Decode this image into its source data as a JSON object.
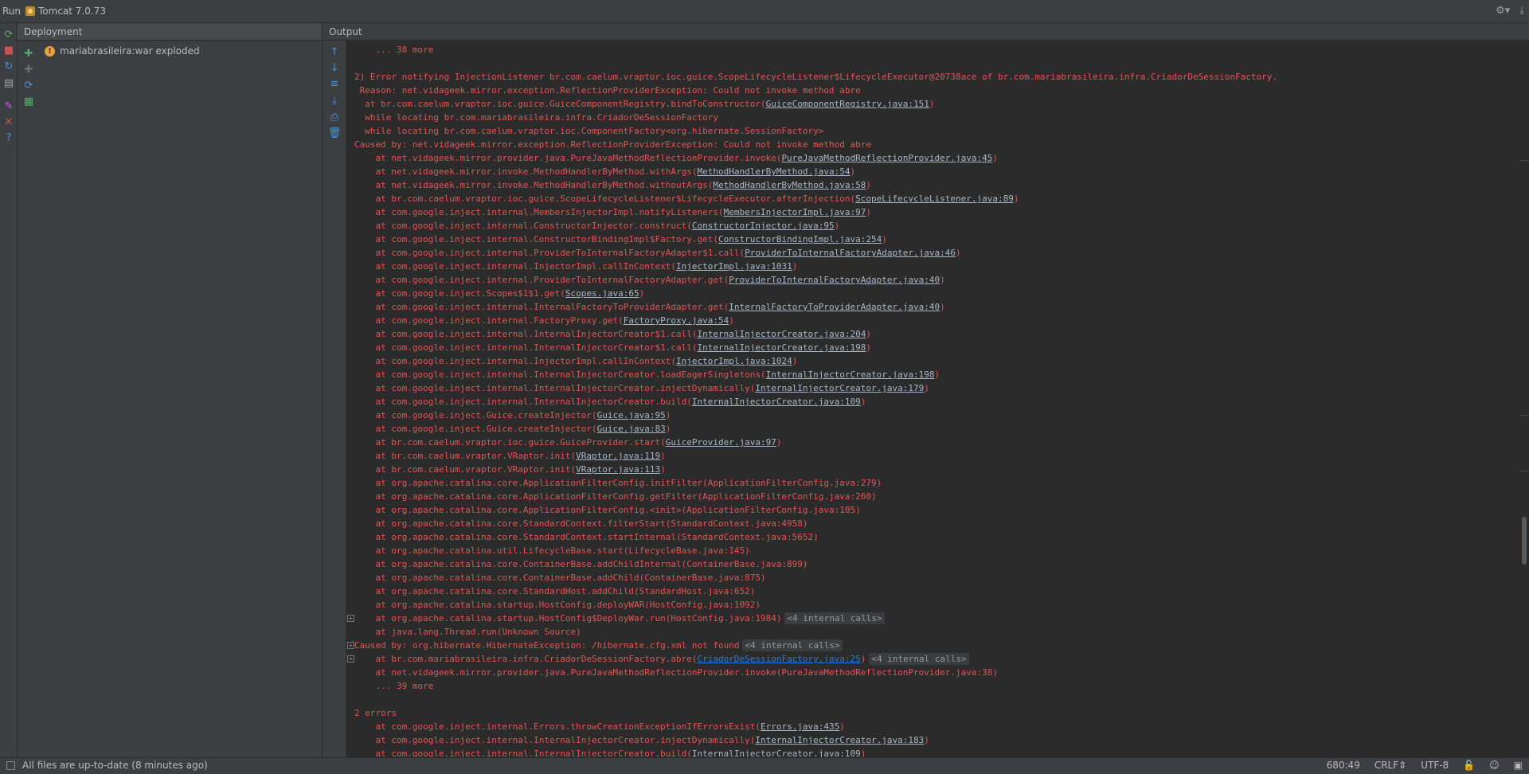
{
  "window": {
    "run_label": "Run",
    "config_name": "Tomcat 7.0.73"
  },
  "left_toolbar": [
    {
      "name": "rerun-icon",
      "glyph": "⟳",
      "color": "#59a869"
    },
    {
      "name": "stop-icon",
      "glyph": "■",
      "color": "#c75450"
    },
    {
      "name": "update-icon",
      "glyph": "↻",
      "color": "#4a90d9"
    },
    {
      "name": "layout-icon",
      "glyph": "▤",
      "color": "#a0a0a0"
    },
    {
      "name": "pin-icon",
      "glyph": "✎",
      "color": "#c05edb"
    },
    {
      "name": "close-icon",
      "glyph": "✕",
      "color": "#c75450"
    },
    {
      "name": "help-icon",
      "glyph": "?",
      "color": "#4a90d9"
    }
  ],
  "deployment": {
    "header": "Deployment",
    "items": [
      {
        "label": "mariabrasileira:war exploded",
        "status": "warning"
      }
    ],
    "tools": [
      {
        "name": "deploy-icon",
        "glyph": "✚",
        "color": "#59a869"
      },
      {
        "name": "undeploy-icon",
        "glyph": "✚",
        "color": "#6e6e6e"
      },
      {
        "name": "refresh-deploy-icon",
        "glyph": "⟳",
        "color": "#4a90d9"
      },
      {
        "name": "artifact-icon",
        "glyph": "▦",
        "color": "#59a869"
      }
    ]
  },
  "output": {
    "header": "Output",
    "tools": [
      {
        "name": "scroll-up-icon",
        "glyph": "↑"
      },
      {
        "name": "scroll-down-icon",
        "glyph": "↓"
      },
      {
        "name": "soft-wrap-icon",
        "glyph": "≡"
      },
      {
        "name": "scroll-to-end-icon",
        "glyph": "⤓"
      },
      {
        "name": "print-icon",
        "glyph": "⎙"
      },
      {
        "name": "clear-all-icon",
        "glyph": "🗑"
      }
    ],
    "lines": [
      {
        "indent": "    ",
        "parts": [
          {
            "t": "... 38 more"
          }
        ]
      },
      {
        "indent": "",
        "parts": []
      },
      {
        "indent": "",
        "parts": [
          {
            "t": "2) Error notifying InjectionListener br.com.caelum.vraptor.ioc.guice.ScopeLifecycleListener$LifecycleExecutor@20738ace of br.com.mariabrasileira.infra.CriadorDeSessionFactory."
          }
        ]
      },
      {
        "indent": " ",
        "parts": [
          {
            "t": "Reason: net.vidageek.mirror.exception.ReflectionProviderException: Could not invoke method abre"
          }
        ]
      },
      {
        "indent": "  ",
        "parts": [
          {
            "t": "at br.com.caelum.vraptor.ioc.guice.GuiceComponentRegistry.bindToConstructor("
          },
          {
            "t": "GuiceComponentRegistry.java:151",
            "link": true
          },
          {
            "t": ")"
          }
        ]
      },
      {
        "indent": "  ",
        "parts": [
          {
            "t": "while locating br.com.mariabrasileira.infra.CriadorDeSessionFactory"
          }
        ]
      },
      {
        "indent": "  ",
        "parts": [
          {
            "t": "while locating br.com.caelum.vraptor.ioc.ComponentFactory<org.hibernate.SessionFactory>"
          }
        ]
      },
      {
        "indent": "",
        "parts": [
          {
            "t": "Caused by: net.vidageek.mirror.exception.ReflectionProviderException: Could not invoke method abre"
          }
        ]
      },
      {
        "indent": "    ",
        "parts": [
          {
            "t": "at net.vidageek.mirror.provider.java.PureJavaMethodReflectionProvider.invoke("
          },
          {
            "t": "PureJavaMethodReflectionProvider.java:45",
            "link": true
          },
          {
            "t": ")"
          }
        ]
      },
      {
        "indent": "    ",
        "parts": [
          {
            "t": "at net.vidageek.mirror.invoke.MethodHandlerByMethod.withArgs("
          },
          {
            "t": "MethodHandlerByMethod.java:54",
            "link": true
          },
          {
            "t": ")"
          }
        ]
      },
      {
        "indent": "    ",
        "parts": [
          {
            "t": "at net.vidageek.mirror.invoke.MethodHandlerByMethod.withoutArgs("
          },
          {
            "t": "MethodHandlerByMethod.java:58",
            "link": true
          },
          {
            "t": ")"
          }
        ]
      },
      {
        "indent": "    ",
        "parts": [
          {
            "t": "at br.com.caelum.vraptor.ioc.guice.ScopeLifecycleListener$LifecycleExecutor.afterInjection("
          },
          {
            "t": "ScopeLifecycleListener.java:89",
            "link": true
          },
          {
            "t": ")"
          }
        ]
      },
      {
        "indent": "    ",
        "parts": [
          {
            "t": "at com.google.inject.internal.MembersInjectorImpl.notifyListeners("
          },
          {
            "t": "MembersInjectorImpl.java:97",
            "link": true
          },
          {
            "t": ")"
          }
        ]
      },
      {
        "indent": "    ",
        "parts": [
          {
            "t": "at com.google.inject.internal.ConstructorInjector.construct("
          },
          {
            "t": "ConstructorInjector.java:95",
            "link": true
          },
          {
            "t": ")"
          }
        ]
      },
      {
        "indent": "    ",
        "parts": [
          {
            "t": "at com.google.inject.internal.ConstructorBindingImpl$Factory.get("
          },
          {
            "t": "ConstructorBindingImpl.java:254",
            "link": true
          },
          {
            "t": ")"
          }
        ]
      },
      {
        "indent": "    ",
        "parts": [
          {
            "t": "at com.google.inject.internal.ProviderToInternalFactoryAdapter$1.call("
          },
          {
            "t": "ProviderToInternalFactoryAdapter.java:46",
            "link": true
          },
          {
            "t": ")"
          }
        ]
      },
      {
        "indent": "    ",
        "parts": [
          {
            "t": "at com.google.inject.internal.InjectorImpl.callInContext("
          },
          {
            "t": "InjectorImpl.java:1031",
            "link": true
          },
          {
            "t": ")"
          }
        ]
      },
      {
        "indent": "    ",
        "parts": [
          {
            "t": "at com.google.inject.internal.ProviderToInternalFactoryAdapter.get("
          },
          {
            "t": "ProviderToInternalFactoryAdapter.java:40",
            "link": true
          },
          {
            "t": ")"
          }
        ]
      },
      {
        "indent": "    ",
        "parts": [
          {
            "t": "at com.google.inject.Scopes$1$1.get("
          },
          {
            "t": "Scopes.java:65",
            "link": true
          },
          {
            "t": ")"
          }
        ]
      },
      {
        "indent": "    ",
        "parts": [
          {
            "t": "at com.google.inject.internal.InternalFactoryToProviderAdapter.get("
          },
          {
            "t": "InternalFactoryToProviderAdapter.java:40",
            "link": true
          },
          {
            "t": ")"
          }
        ]
      },
      {
        "indent": "    ",
        "parts": [
          {
            "t": "at com.google.inject.internal.FactoryProxy.get("
          },
          {
            "t": "FactoryProxy.java:54",
            "link": true
          },
          {
            "t": ")"
          }
        ]
      },
      {
        "indent": "    ",
        "parts": [
          {
            "t": "at com.google.inject.internal.InternalInjectorCreator$1.call("
          },
          {
            "t": "InternalInjectorCreator.java:204",
            "link": true
          },
          {
            "t": ")"
          }
        ]
      },
      {
        "indent": "    ",
        "parts": [
          {
            "t": "at com.google.inject.internal.InternalInjectorCreator$1.call("
          },
          {
            "t": "InternalInjectorCreator.java:198",
            "link": true
          },
          {
            "t": ")"
          }
        ]
      },
      {
        "indent": "    ",
        "parts": [
          {
            "t": "at com.google.inject.internal.InjectorImpl.callInContext("
          },
          {
            "t": "InjectorImpl.java:1024",
            "link": true
          },
          {
            "t": ")"
          }
        ]
      },
      {
        "indent": "    ",
        "parts": [
          {
            "t": "at com.google.inject.internal.InternalInjectorCreator.loadEagerSingletons("
          },
          {
            "t": "InternalInjectorCreator.java:198",
            "link": true
          },
          {
            "t": ")"
          }
        ]
      },
      {
        "indent": "    ",
        "parts": [
          {
            "t": "at com.google.inject.internal.InternalInjectorCreator.injectDynamically("
          },
          {
            "t": "InternalInjectorCreator.java:179",
            "link": true
          },
          {
            "t": ")"
          }
        ]
      },
      {
        "indent": "    ",
        "parts": [
          {
            "t": "at com.google.inject.internal.InternalInjectorCreator.build("
          },
          {
            "t": "InternalInjectorCreator.java:109",
            "link": true
          },
          {
            "t": ")"
          }
        ]
      },
      {
        "indent": "    ",
        "parts": [
          {
            "t": "at com.google.inject.Guice.createInjector("
          },
          {
            "t": "Guice.java:95",
            "link": true
          },
          {
            "t": ")"
          }
        ]
      },
      {
        "indent": "    ",
        "parts": [
          {
            "t": "at com.google.inject.Guice.createInjector("
          },
          {
            "t": "Guice.java:83",
            "link": true
          },
          {
            "t": ")"
          }
        ]
      },
      {
        "indent": "    ",
        "parts": [
          {
            "t": "at br.com.caelum.vraptor.ioc.guice.GuiceProvider.start("
          },
          {
            "t": "GuiceProvider.java:97",
            "link": true
          },
          {
            "t": ")"
          }
        ]
      },
      {
        "indent": "    ",
        "parts": [
          {
            "t": "at br.com.caelum.vraptor.VRaptor.init("
          },
          {
            "t": "VRaptor.java:119",
            "link": true
          },
          {
            "t": ")"
          }
        ]
      },
      {
        "indent": "    ",
        "parts": [
          {
            "t": "at br.com.caelum.vraptor.VRaptor.init("
          },
          {
            "t": "VRaptor.java:113",
            "link": true
          },
          {
            "t": ")"
          }
        ]
      },
      {
        "indent": "    ",
        "parts": [
          {
            "t": "at org.apache.catalina.core.ApplicationFilterConfig.initFilter(ApplicationFilterConfig.java:279)"
          }
        ]
      },
      {
        "indent": "    ",
        "parts": [
          {
            "t": "at org.apache.catalina.core.ApplicationFilterConfig.getFilter(ApplicationFilterConfig.java:260)"
          }
        ]
      },
      {
        "indent": "    ",
        "parts": [
          {
            "t": "at org.apache.catalina.core.ApplicationFilterConfig.<init>(ApplicationFilterConfig.java:105)"
          }
        ]
      },
      {
        "indent": "    ",
        "parts": [
          {
            "t": "at org.apache.catalina.core.StandardContext.filterStart(StandardContext.java:4958)"
          }
        ]
      },
      {
        "indent": "    ",
        "parts": [
          {
            "t": "at org.apache.catalina.core.StandardContext.startInternal(StandardContext.java:5652)"
          }
        ]
      },
      {
        "indent": "    ",
        "parts": [
          {
            "t": "at org.apache.catalina.util.LifecycleBase.start(LifecycleBase.java:145)"
          }
        ]
      },
      {
        "indent": "    ",
        "parts": [
          {
            "t": "at org.apache.catalina.core.ContainerBase.addChildInternal(ContainerBase.java:899)"
          }
        ]
      },
      {
        "indent": "    ",
        "parts": [
          {
            "t": "at org.apache.catalina.core.ContainerBase.addChild(ContainerBase.java:875)"
          }
        ]
      },
      {
        "indent": "    ",
        "parts": [
          {
            "t": "at org.apache.catalina.core.StandardHost.addChild(StandardHost.java:652)"
          }
        ]
      },
      {
        "indent": "    ",
        "parts": [
          {
            "t": "at org.apache.catalina.startup.HostConfig.deployWAR(HostConfig.java:1092)"
          }
        ]
      },
      {
        "indent": "    ",
        "fold": true,
        "parts": [
          {
            "t": "at org.apache.catalina.startup.HostConfig$DeployWar.run(HostConfig.java:1984)"
          },
          {
            "t": "<4 internal calls>",
            "badge": true
          }
        ]
      },
      {
        "indent": "    ",
        "parts": [
          {
            "t": "at java.lang.Thread.run(Unknown Source)"
          }
        ]
      },
      {
        "indent": "",
        "fold": true,
        "parts": [
          {
            "t": "Caused by: org.hibernate.HibernateException: /hibernate.cfg.xml not found"
          },
          {
            "t": "<4 internal calls>",
            "badge": true
          }
        ]
      },
      {
        "indent": "    ",
        "fold": true,
        "parts": [
          {
            "t": "at br.com.mariabrasileira.infra.CriadorDeSessionFactory.abre("
          },
          {
            "t": "CriadorDeSessionFactory.java:25",
            "link": true,
            "blue": true
          },
          {
            "t": ")"
          },
          {
            "t": "<4 internal calls>",
            "badge": true
          }
        ]
      },
      {
        "indent": "    ",
        "parts": [
          {
            "t": "at net.vidageek.mirror.provider.java.PureJavaMethodReflectionProvider.invoke(PureJavaMethodReflectionProvider.java:38)"
          }
        ]
      },
      {
        "indent": "    ",
        "parts": [
          {
            "t": "... 39 more"
          }
        ]
      },
      {
        "indent": "",
        "parts": []
      },
      {
        "indent": "",
        "parts": [
          {
            "t": "2 errors"
          }
        ]
      },
      {
        "indent": "    ",
        "parts": [
          {
            "t": "at com.google.inject.internal.Errors.throwCreationExceptionIfErrorsExist("
          },
          {
            "t": "Errors.java:435",
            "link": true
          },
          {
            "t": ")"
          }
        ]
      },
      {
        "indent": "    ",
        "parts": [
          {
            "t": "at com.google.inject.internal.InternalInjectorCreator.injectDynamically("
          },
          {
            "t": "InternalInjectorCreator.java:183",
            "link": true
          },
          {
            "t": ")"
          }
        ]
      },
      {
        "indent": "    ",
        "parts": [
          {
            "t": "at com.google.inject.internal.InternalInjectorCreator.build("
          },
          {
            "t": "InternalInjectorCreator.java:109",
            "link": true
          },
          {
            "t": ")"
          }
        ]
      }
    ]
  },
  "statusbar": {
    "message": "All files are up-to-date (8 minutes ago)",
    "position": "680:49",
    "line_separator": "CRLF",
    "encoding": "UTF-8"
  },
  "colors": {
    "error_text": "#e05555",
    "link_text": "#a9b7c6",
    "link_blue": "#287bde",
    "panel_bg": "#3c3f41",
    "console_bg": "#2b2b2b"
  }
}
